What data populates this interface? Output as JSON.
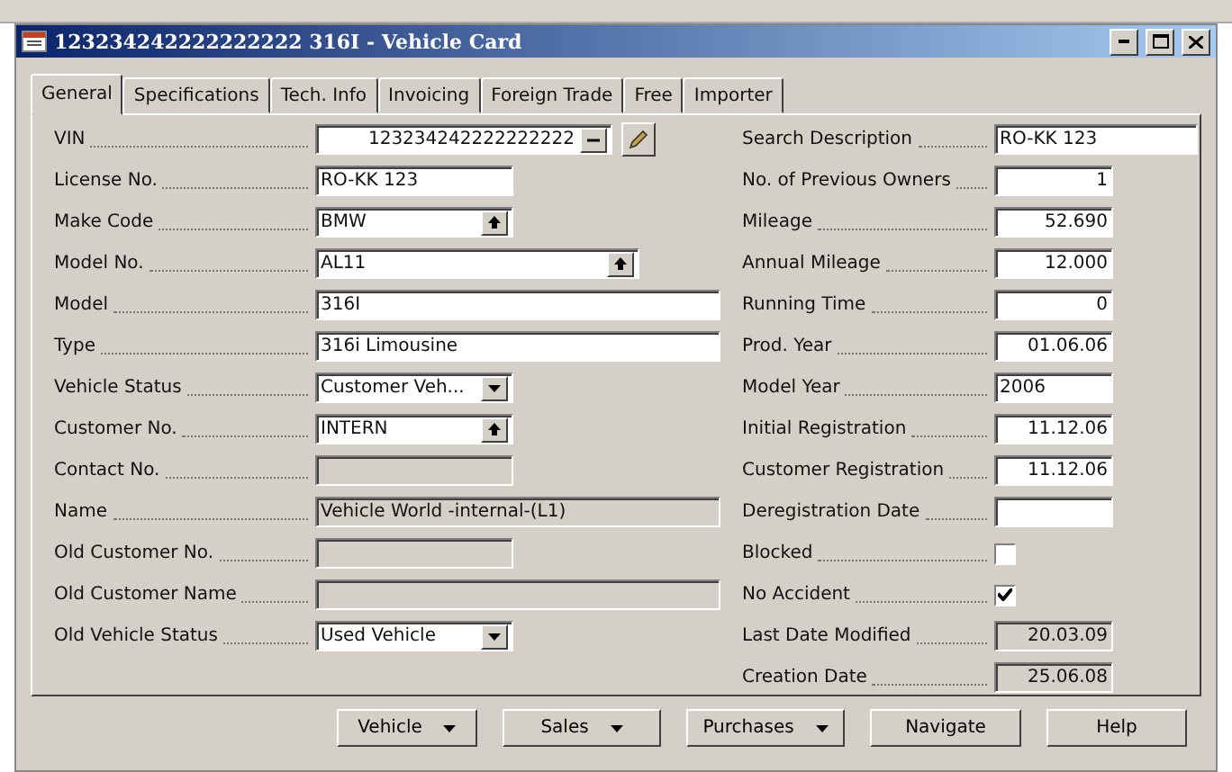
{
  "window": {
    "title": "123234242222222222 316I - Vehicle Card"
  },
  "tabs": [
    {
      "label": "General",
      "selected": true
    },
    {
      "label": "Specifications",
      "selected": false
    },
    {
      "label": "Tech. Info",
      "selected": false
    },
    {
      "label": "Invoicing",
      "selected": false
    },
    {
      "label": "Foreign Trade",
      "selected": false
    },
    {
      "label": "Free",
      "selected": false
    },
    {
      "label": "Importer",
      "selected": false
    }
  ],
  "left_fields": [
    {
      "label": "VIN",
      "kind": "assist",
      "value": "123234242222222222",
      "disabled": false
    },
    {
      "label": "License No.",
      "kind": "text",
      "value": "RO-KK 123",
      "disabled": false
    },
    {
      "label": "Make Code",
      "kind": "lookup",
      "value": "BMW",
      "disabled": false
    },
    {
      "label": "Model No.",
      "kind": "lookup",
      "value": "AL11",
      "disabled": false
    },
    {
      "label": "Model",
      "kind": "text",
      "value": "316I",
      "disabled": false
    },
    {
      "label": "Type",
      "kind": "text",
      "value": "316i Limousine",
      "disabled": false
    },
    {
      "label": "Vehicle Status",
      "kind": "dropdown",
      "value": "Customer Veh...",
      "disabled": false
    },
    {
      "label": "Customer No.",
      "kind": "lookup",
      "value": "INTERN",
      "disabled": false
    },
    {
      "label": "Contact No.",
      "kind": "text",
      "disabled": true
    },
    {
      "label": "Name",
      "kind": "text",
      "value": "Vehicle World -internal-(L1)",
      "disabled": true
    },
    {
      "label": "Old Customer No.",
      "kind": "text",
      "disabled": true
    },
    {
      "label": "Old Customer Name",
      "kind": "text",
      "disabled": true
    },
    {
      "label": "Old Vehicle Status",
      "kind": "dropdown",
      "value": "Used Vehicle",
      "disabled": false
    }
  ],
  "right_fields": [
    {
      "label": "Search Description",
      "kind": "text",
      "value": "RO-KK 123",
      "disabled": false
    },
    {
      "label": "No. of Previous Owners",
      "kind": "number",
      "value": "1",
      "disabled": false
    },
    {
      "label": "Mileage",
      "kind": "number",
      "value": "52.690",
      "disabled": false
    },
    {
      "label": "Annual Mileage",
      "kind": "number",
      "value": "12.000",
      "disabled": false
    },
    {
      "label": "Running Time",
      "kind": "number",
      "value": "0",
      "disabled": false
    },
    {
      "label": "Prod. Year",
      "kind": "number",
      "value": "01.06.06",
      "disabled": false
    },
    {
      "label": "Model Year",
      "kind": "text",
      "value": "2006",
      "disabled": false
    },
    {
      "label": "Initial Registration",
      "kind": "number",
      "value": "11.12.06",
      "disabled": false
    },
    {
      "label": "Customer Registration",
      "kind": "number",
      "value": "11.12.06",
      "disabled": false
    },
    {
      "label": "Deregistration Date",
      "kind": "text",
      "disabled": false
    },
    {
      "label": "Blocked",
      "kind": "checkbox",
      "checked": false
    },
    {
      "label": "No Accident",
      "kind": "checkbox",
      "checked": true
    },
    {
      "label": "Last Date Modified",
      "kind": "number",
      "value": "20.03.09",
      "disabled": true
    },
    {
      "label": "Creation Date",
      "kind": "number",
      "value": "25.06.08",
      "disabled": true
    }
  ],
  "buttons": [
    {
      "label": "Vehicle",
      "menu": true
    },
    {
      "label": "Sales",
      "menu": true
    },
    {
      "label": "Purchases",
      "menu": true
    },
    {
      "label": "Navigate",
      "menu": false
    },
    {
      "label": "Help",
      "menu": false
    }
  ]
}
